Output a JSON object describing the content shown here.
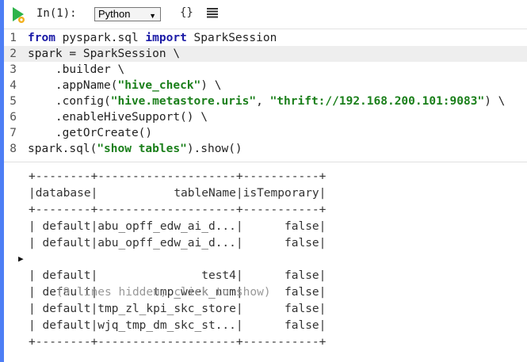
{
  "toolbar": {
    "cell_label": "In(1):",
    "language": "Python",
    "braces_label": "{}"
  },
  "editor": {
    "lines": [
      {
        "n": "1",
        "parts": [
          {
            "t": "from",
            "c": "kw"
          },
          {
            "t": " pyspark.sql ",
            "c": ""
          },
          {
            "t": "import",
            "c": "kw"
          },
          {
            "t": " SparkSession",
            "c": ""
          }
        ]
      },
      {
        "n": "2",
        "parts": [
          {
            "t": "spark = SparkSession \\",
            "c": ""
          }
        ],
        "active": true
      },
      {
        "n": "3",
        "parts": [
          {
            "t": "    .builder \\",
            "c": ""
          }
        ]
      },
      {
        "n": "4",
        "parts": [
          {
            "t": "    .appName(",
            "c": ""
          },
          {
            "t": "\"hive_check\"",
            "c": "str"
          },
          {
            "t": ") \\",
            "c": ""
          }
        ]
      },
      {
        "n": "5",
        "parts": [
          {
            "t": "    .config(",
            "c": ""
          },
          {
            "t": "\"hive.metastore.uris\"",
            "c": "str"
          },
          {
            "t": ", ",
            "c": ""
          },
          {
            "t": "\"thrift://192.168.200.101:9083\"",
            "c": "str"
          },
          {
            "t": ") \\",
            "c": ""
          }
        ]
      },
      {
        "n": "6",
        "parts": [
          {
            "t": "    .enableHiveSupport() \\",
            "c": ""
          }
        ]
      },
      {
        "n": "7",
        "parts": [
          {
            "t": "    .getOrCreate()",
            "c": ""
          }
        ]
      },
      {
        "n": "8",
        "parts": [
          {
            "t": "spark.sql(",
            "c": ""
          },
          {
            "t": "\"show tables\"",
            "c": "str"
          },
          {
            "t": ").show()",
            "c": ""
          }
        ]
      }
    ]
  },
  "output": {
    "border": "+--------+--------------------+-----------+",
    "header": "|database|           tableName|isTemporary|",
    "rows_top": [
      "| default|abu_opff_edw_ai_d...|      false|",
      "| default|abu_opff_edw_ai_d...|      false|"
    ],
    "hidden_note": "(9 lines hidden; click to show)",
    "rows_bottom": [
      "| default|               test4|      false|",
      "| default|        tmp_week_num|      false|",
      "| default|tmp_zl_kpi_skc_store|      false|",
      "| default|wjq_tmp_dm_skc_st...|      false|"
    ]
  },
  "colors": {
    "accent_bar": "#4d7ef5",
    "keyword": "#1a1aa6",
    "string": "#1a7f1a",
    "run_green": "#2db34a"
  }
}
